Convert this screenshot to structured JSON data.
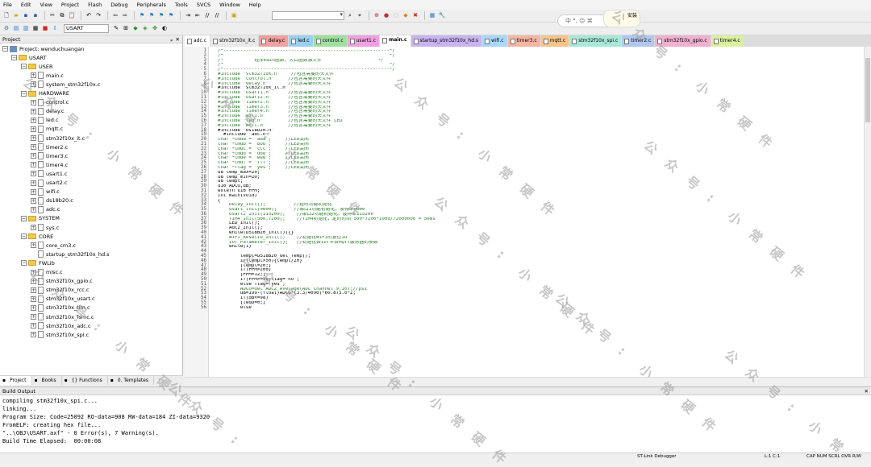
{
  "menu": [
    "File",
    "Edit",
    "View",
    "Project",
    "Flash",
    "Debug",
    "Peripherals",
    "Tools",
    "SVCS",
    "Window",
    "Help"
  ],
  "toolbar": {
    "target": "USART"
  },
  "ime": {
    "text": "中 °, ☺ ⌘"
  },
  "avatar": {
    "label": "安装"
  },
  "project_panel": {
    "title": "Project",
    "pin": "ᵩ",
    "close": "✕",
    "tree": [
      {
        "label": "Project: wenduchuangan",
        "level": 0,
        "kind": "project",
        "exp": "−"
      },
      {
        "label": "USART",
        "level": 1,
        "kind": "folder",
        "exp": "−"
      },
      {
        "label": "USER",
        "level": 2,
        "kind": "folder",
        "exp": "−"
      },
      {
        "label": "main.c",
        "level": 3,
        "kind": "file",
        "exp": "+"
      },
      {
        "label": "system_stm32f10x.c",
        "level": 3,
        "kind": "file",
        "exp": "+"
      },
      {
        "label": "HARDWARE",
        "level": 2,
        "kind": "folder",
        "exp": "−"
      },
      {
        "label": "control.c",
        "level": 3,
        "kind": "file",
        "exp": "+"
      },
      {
        "label": "delay.c",
        "level": 3,
        "kind": "file",
        "exp": "+"
      },
      {
        "label": "led.c",
        "level": 3,
        "kind": "file",
        "exp": "+"
      },
      {
        "label": "mqtt.c",
        "level": 3,
        "kind": "file",
        "exp": "+"
      },
      {
        "label": "stm32f10x_it.c",
        "level": 3,
        "kind": "file",
        "exp": "+"
      },
      {
        "label": "timer2.c",
        "level": 3,
        "kind": "file",
        "exp": "+"
      },
      {
        "label": "timer3.c",
        "level": 3,
        "kind": "file",
        "exp": "+"
      },
      {
        "label": "timer4.c",
        "level": 3,
        "kind": "file",
        "exp": "+"
      },
      {
        "label": "usart1.c",
        "level": 3,
        "kind": "file",
        "exp": "+"
      },
      {
        "label": "usart2.c",
        "level": 3,
        "kind": "file",
        "exp": "+"
      },
      {
        "label": "wifi.c",
        "level": 3,
        "kind": "file",
        "exp": "+"
      },
      {
        "label": "ds18b20.c",
        "level": 3,
        "kind": "file",
        "exp": "+"
      },
      {
        "label": "adc.c",
        "level": 3,
        "kind": "file",
        "exp": "+"
      },
      {
        "label": "SYSTEM",
        "level": 2,
        "kind": "folder",
        "exp": "−"
      },
      {
        "label": "sys.c",
        "level": 3,
        "kind": "file",
        "exp": "+"
      },
      {
        "label": "CORE",
        "level": 2,
        "kind": "folder",
        "exp": "−"
      },
      {
        "label": "core_cm3.c",
        "level": 3,
        "kind": "file",
        "exp": "+"
      },
      {
        "label": "startup_stm32f10x_hd.s",
        "level": 3,
        "kind": "file",
        "exp": ""
      },
      {
        "label": "FWLib",
        "level": 2,
        "kind": "folder",
        "exp": "−"
      },
      {
        "label": "misc.c",
        "level": 3,
        "kind": "file",
        "exp": "+"
      },
      {
        "label": "stm32f10x_gpio.c",
        "level": 3,
        "kind": "file",
        "exp": "+"
      },
      {
        "label": "stm32f10x_rcc.c",
        "level": 3,
        "kind": "file",
        "exp": "+"
      },
      {
        "label": "stm32f10x_usart.c",
        "level": 3,
        "kind": "file",
        "exp": "+"
      },
      {
        "label": "stm32f10x_tim.c",
        "level": 3,
        "kind": "file",
        "exp": "+"
      },
      {
        "label": "stm32f10x_fsmc.c",
        "level": 3,
        "kind": "file",
        "exp": "+"
      },
      {
        "label": "stm32f10x_adc.c",
        "level": 3,
        "kind": "file",
        "exp": "+"
      },
      {
        "label": "stm32f10x_spi.c",
        "level": 3,
        "kind": "file",
        "exp": "+"
      }
    ],
    "tabs": [
      "Project",
      "Books",
      "{} Functions",
      "0. Templates"
    ]
  },
  "file_tabs": [
    {
      "label": "adc.c",
      "color": "#ffffff"
    },
    {
      "label": "stm32f10x_it.c",
      "color": "#e8e8e8"
    },
    {
      "label": "delay.c",
      "color": "#f2a0a0"
    },
    {
      "label": "led.c",
      "color": "#9ad0f2"
    },
    {
      "label": "control.c",
      "color": "#9fdf9f"
    },
    {
      "label": "usart1.c",
      "color": "#f0a0e0"
    },
    {
      "label": "main.c",
      "color": "#ffffff"
    },
    {
      "label": "startup_stm32f10x_hd.s",
      "color": "#c9b3f0"
    },
    {
      "label": "wifi.c",
      "color": "#a8d8f8"
    },
    {
      "label": "timer3.c",
      "color": "#f5b5a0"
    },
    {
      "label": "mqtt.c",
      "color": "#f7c48a"
    },
    {
      "label": "stm32f10x_spi.c",
      "color": "#a8e8d8"
    },
    {
      "label": "timer2.c",
      "color": "#b0c8f0"
    },
    {
      "label": "stm32f10x_gpio.c",
      "color": "#f0b0d0"
    },
    {
      "label": "timer4.c",
      "color": "#d8f0a0"
    }
  ],
  "code": {
    "first_line": 1,
    "lines": [
      "/*-----------------------------------------------------------*/",
      "/*                                                           */",
      "/*           程序main函数，入口函数源文件                    */",
      "/*                                                           */",
      "/*-----------------------------------------------------------*/",
      "#include \"stm32f10x.h\"    //包含需要的头文件",
      "#include \"control.h\"     //包含需要的头文件",
      "#include \"delay.h\"       //包含需要的头文件",
      "#include \"stm32f10x_it.h\"",
      "#include \"usart1.h\"      //包含需要的头文件",
      "#include \"usart2.h\"      //包含需要的头文件",
      "#include \"timer2.h\"      //包含需要的头文件",
      "#include \"timer3.h\"      //包含需要的头文件",
      "#include \"timer4.h\"      //包含需要的头文件",
      "#include \"wifi.h\"        //包含需要的头文件",
      "#include \"led.h\"         //包含需要的头文件 LED",
      "#include \"mqtt.h\"        //包含需要的头文件",
      "#include \"ds18b20.h\"",
      "  #include \"adc.h\"",
      "char *cmda = \"aaa\";     //LED关闭",
      "char *cmdb = \"bbb\";     //LED关闭",
      "char *cmdc = \"ccc\";     //LED关闭",
      "char *cmdd = \"ddd\";     //LED关闭",
      "char *cmde = \"eee\";     //LED关闭",
      "char *cmdf = \"fff\";     //LED关闭",
      "char *flag = \"yes\";     //LED关闭",
      "u8 temp_max=20;",
      "u8 temp_min=20;",
      "u8 tempt;",
      "u16 ADCG,dB;",
      "extern u16 PPM;",
      "int main(void)",
      "{",
      "    Delay_Init();          //延时功能初始化",
      "    usart_init(9600);      //串口1功能初始化，波特率9600",
      "    Usart2_Init(115200);    //串口2功能初始化，波特率115200",
      "    TIM4_Init(500,7200);    //TIM4初始化，定时时间 500*7200*1000/72000000 = 50ms",
      "    LED_Init();",
      "    Adc2_Init();",
      "    while(DS18B20_Init()){}",
      "    WiFi_ResetIO_Init();    //初始化WiFi的复位IO",
      "    IoT_Parameter_Init();   //初始化云IoT平台MQTT服务器的参数",
      "    while(1)",
      "",
      "        tempt=DS18B20_Get_Temp();",
      "        if(tempt>50){tempt/20}",
      "        [tempt=20;]",
      "        if(PPM>200)",
      "        [PPM=12;]",
      "        if(PPM>=50)flag=\"no\";",
      "        else flag=\"yes\";",
      "        ADCG=Get_ADC2_Average(ADC_Channel_9,10);//ps1",
      "        dB=199-(float)ADCG*(3.3/4096)*60.875.0*2;",
      "        if(dB<=98)",
      "        [ledD=0;]",
      "        else"
    ]
  },
  "build_output": {
    "title": "Build Output",
    "close": "✕",
    "lines": [
      "compiling stm32f10x_spi.c...",
      "linking...",
      "Program Size: Code=25092 RO-data=908 RW-data=184 ZI-data=9320",
      "FromELF: creating hex file...",
      "\"..\\OBJ\\USART.axf\" - 0 Error(s), 7 Warning(s).",
      "Build Time Elapsed:  00:00:08"
    ]
  },
  "status": {
    "debugger": "ST-Link Debugger",
    "pos": "L:1 C:1",
    "flags": "CAP NUM SCRL OVR R/W"
  },
  "watermark": {
    "chars": [
      "公",
      "众",
      "号",
      ":",
      "小",
      "常",
      "硬",
      "件"
    ]
  }
}
